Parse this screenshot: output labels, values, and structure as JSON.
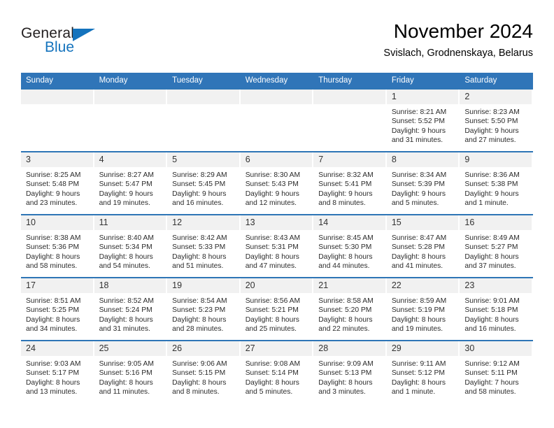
{
  "brand": {
    "name_part1": "General",
    "name_part2": "Blue",
    "logo_color": "#1473bd",
    "text_color": "#231f20"
  },
  "header": {
    "title": "November 2024",
    "subtitle": "Svislach, Grodnenskaya, Belarus"
  },
  "theme": {
    "header_blue": "#3075b8",
    "separator_blue": "#2e75b6",
    "daynum_band": "#f1f1f1"
  },
  "weekday_headers": [
    "Sunday",
    "Monday",
    "Tuesday",
    "Wednesday",
    "Thursday",
    "Friday",
    "Saturday"
  ],
  "labels": {
    "sunrise_prefix": "Sunrise:",
    "sunset_prefix": "Sunset:",
    "daylight_prefix": "Daylight:"
  },
  "weeks": [
    [
      {
        "day": "",
        "sunrise": "",
        "sunset": "",
        "daylight_a": "",
        "daylight_b": ""
      },
      {
        "day": "",
        "sunrise": "",
        "sunset": "",
        "daylight_a": "",
        "daylight_b": ""
      },
      {
        "day": "",
        "sunrise": "",
        "sunset": "",
        "daylight_a": "",
        "daylight_b": ""
      },
      {
        "day": "",
        "sunrise": "",
        "sunset": "",
        "daylight_a": "",
        "daylight_b": ""
      },
      {
        "day": "",
        "sunrise": "",
        "sunset": "",
        "daylight_a": "",
        "daylight_b": ""
      },
      {
        "day": "1",
        "sunrise": "Sunrise: 8:21 AM",
        "sunset": "Sunset: 5:52 PM",
        "daylight_a": "Daylight: 9 hours",
        "daylight_b": "and 31 minutes."
      },
      {
        "day": "2",
        "sunrise": "Sunrise: 8:23 AM",
        "sunset": "Sunset: 5:50 PM",
        "daylight_a": "Daylight: 9 hours",
        "daylight_b": "and 27 minutes."
      }
    ],
    [
      {
        "day": "3",
        "sunrise": "Sunrise: 8:25 AM",
        "sunset": "Sunset: 5:48 PM",
        "daylight_a": "Daylight: 9 hours",
        "daylight_b": "and 23 minutes."
      },
      {
        "day": "4",
        "sunrise": "Sunrise: 8:27 AM",
        "sunset": "Sunset: 5:47 PM",
        "daylight_a": "Daylight: 9 hours",
        "daylight_b": "and 19 minutes."
      },
      {
        "day": "5",
        "sunrise": "Sunrise: 8:29 AM",
        "sunset": "Sunset: 5:45 PM",
        "daylight_a": "Daylight: 9 hours",
        "daylight_b": "and 16 minutes."
      },
      {
        "day": "6",
        "sunrise": "Sunrise: 8:30 AM",
        "sunset": "Sunset: 5:43 PM",
        "daylight_a": "Daylight: 9 hours",
        "daylight_b": "and 12 minutes."
      },
      {
        "day": "7",
        "sunrise": "Sunrise: 8:32 AM",
        "sunset": "Sunset: 5:41 PM",
        "daylight_a": "Daylight: 9 hours",
        "daylight_b": "and 8 minutes."
      },
      {
        "day": "8",
        "sunrise": "Sunrise: 8:34 AM",
        "sunset": "Sunset: 5:39 PM",
        "daylight_a": "Daylight: 9 hours",
        "daylight_b": "and 5 minutes."
      },
      {
        "day": "9",
        "sunrise": "Sunrise: 8:36 AM",
        "sunset": "Sunset: 5:38 PM",
        "daylight_a": "Daylight: 9 hours",
        "daylight_b": "and 1 minute."
      }
    ],
    [
      {
        "day": "10",
        "sunrise": "Sunrise: 8:38 AM",
        "sunset": "Sunset: 5:36 PM",
        "daylight_a": "Daylight: 8 hours",
        "daylight_b": "and 58 minutes."
      },
      {
        "day": "11",
        "sunrise": "Sunrise: 8:40 AM",
        "sunset": "Sunset: 5:34 PM",
        "daylight_a": "Daylight: 8 hours",
        "daylight_b": "and 54 minutes."
      },
      {
        "day": "12",
        "sunrise": "Sunrise: 8:42 AM",
        "sunset": "Sunset: 5:33 PM",
        "daylight_a": "Daylight: 8 hours",
        "daylight_b": "and 51 minutes."
      },
      {
        "day": "13",
        "sunrise": "Sunrise: 8:43 AM",
        "sunset": "Sunset: 5:31 PM",
        "daylight_a": "Daylight: 8 hours",
        "daylight_b": "and 47 minutes."
      },
      {
        "day": "14",
        "sunrise": "Sunrise: 8:45 AM",
        "sunset": "Sunset: 5:30 PM",
        "daylight_a": "Daylight: 8 hours",
        "daylight_b": "and 44 minutes."
      },
      {
        "day": "15",
        "sunrise": "Sunrise: 8:47 AM",
        "sunset": "Sunset: 5:28 PM",
        "daylight_a": "Daylight: 8 hours",
        "daylight_b": "and 41 minutes."
      },
      {
        "day": "16",
        "sunrise": "Sunrise: 8:49 AM",
        "sunset": "Sunset: 5:27 PM",
        "daylight_a": "Daylight: 8 hours",
        "daylight_b": "and 37 minutes."
      }
    ],
    [
      {
        "day": "17",
        "sunrise": "Sunrise: 8:51 AM",
        "sunset": "Sunset: 5:25 PM",
        "daylight_a": "Daylight: 8 hours",
        "daylight_b": "and 34 minutes."
      },
      {
        "day": "18",
        "sunrise": "Sunrise: 8:52 AM",
        "sunset": "Sunset: 5:24 PM",
        "daylight_a": "Daylight: 8 hours",
        "daylight_b": "and 31 minutes."
      },
      {
        "day": "19",
        "sunrise": "Sunrise: 8:54 AM",
        "sunset": "Sunset: 5:23 PM",
        "daylight_a": "Daylight: 8 hours",
        "daylight_b": "and 28 minutes."
      },
      {
        "day": "20",
        "sunrise": "Sunrise: 8:56 AM",
        "sunset": "Sunset: 5:21 PM",
        "daylight_a": "Daylight: 8 hours",
        "daylight_b": "and 25 minutes."
      },
      {
        "day": "21",
        "sunrise": "Sunrise: 8:58 AM",
        "sunset": "Sunset: 5:20 PM",
        "daylight_a": "Daylight: 8 hours",
        "daylight_b": "and 22 minutes."
      },
      {
        "day": "22",
        "sunrise": "Sunrise: 8:59 AM",
        "sunset": "Sunset: 5:19 PM",
        "daylight_a": "Daylight: 8 hours",
        "daylight_b": "and 19 minutes."
      },
      {
        "day": "23",
        "sunrise": "Sunrise: 9:01 AM",
        "sunset": "Sunset: 5:18 PM",
        "daylight_a": "Daylight: 8 hours",
        "daylight_b": "and 16 minutes."
      }
    ],
    [
      {
        "day": "24",
        "sunrise": "Sunrise: 9:03 AM",
        "sunset": "Sunset: 5:17 PM",
        "daylight_a": "Daylight: 8 hours",
        "daylight_b": "and 13 minutes."
      },
      {
        "day": "25",
        "sunrise": "Sunrise: 9:05 AM",
        "sunset": "Sunset: 5:16 PM",
        "daylight_a": "Daylight: 8 hours",
        "daylight_b": "and 11 minutes."
      },
      {
        "day": "26",
        "sunrise": "Sunrise: 9:06 AM",
        "sunset": "Sunset: 5:15 PM",
        "daylight_a": "Daylight: 8 hours",
        "daylight_b": "and 8 minutes."
      },
      {
        "day": "27",
        "sunrise": "Sunrise: 9:08 AM",
        "sunset": "Sunset: 5:14 PM",
        "daylight_a": "Daylight: 8 hours",
        "daylight_b": "and 5 minutes."
      },
      {
        "day": "28",
        "sunrise": "Sunrise: 9:09 AM",
        "sunset": "Sunset: 5:13 PM",
        "daylight_a": "Daylight: 8 hours",
        "daylight_b": "and 3 minutes."
      },
      {
        "day": "29",
        "sunrise": "Sunrise: 9:11 AM",
        "sunset": "Sunset: 5:12 PM",
        "daylight_a": "Daylight: 8 hours",
        "daylight_b": "and 1 minute."
      },
      {
        "day": "30",
        "sunrise": "Sunrise: 9:12 AM",
        "sunset": "Sunset: 5:11 PM",
        "daylight_a": "Daylight: 7 hours",
        "daylight_b": "and 58 minutes."
      }
    ]
  ]
}
